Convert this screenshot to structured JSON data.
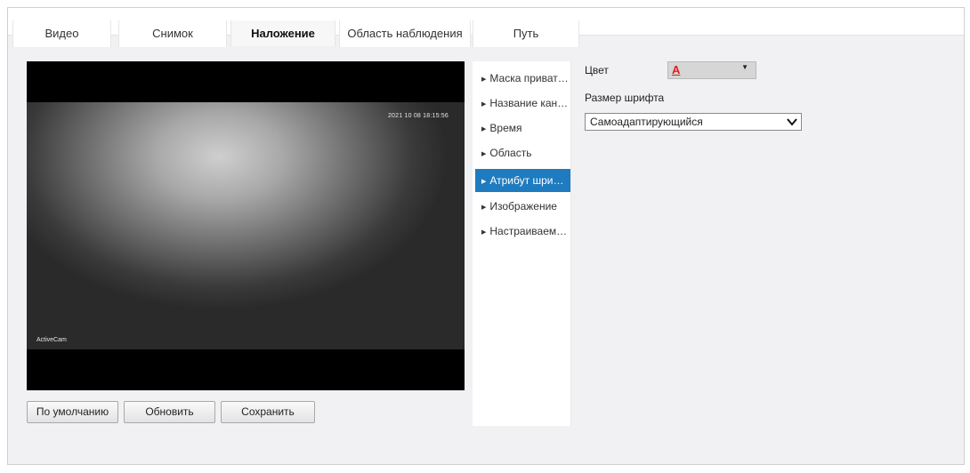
{
  "tabs": [
    {
      "label": "Видео",
      "active": false
    },
    {
      "label": "Снимок",
      "active": false
    },
    {
      "label": "Наложение",
      "active": true
    },
    {
      "label": "Область наблюдения",
      "active": false
    },
    {
      "label": "Путь",
      "active": false
    }
  ],
  "video": {
    "osd_time": "2021 10 08 18:15:56",
    "osd_name": "ActiveCam"
  },
  "buttons": {
    "default_label": "По умолчанию",
    "refresh_label": "Обновить",
    "save_label": "Сохранить"
  },
  "menu": {
    "items": [
      {
        "label": "Маска приват…",
        "active": false
      },
      {
        "label": "Название кан…",
        "active": false
      },
      {
        "label": "Время",
        "active": false
      },
      {
        "label": "Область",
        "active": false
      },
      {
        "label": "Атрибут шри…",
        "active": true
      },
      {
        "label": "Изображение",
        "active": false
      },
      {
        "label": "Настраиваем…",
        "active": false
      }
    ],
    "arrow_glyph": "▶"
  },
  "settings": {
    "color_label": "Цвет",
    "color_glyph": "A",
    "color_value": "#e02020",
    "font_size_label": "Размер шрифта",
    "font_size_value": "Самоадаптирующийся"
  },
  "colors": {
    "accent": "#1f7bbf",
    "panel_bg": "#f1f1f3"
  }
}
